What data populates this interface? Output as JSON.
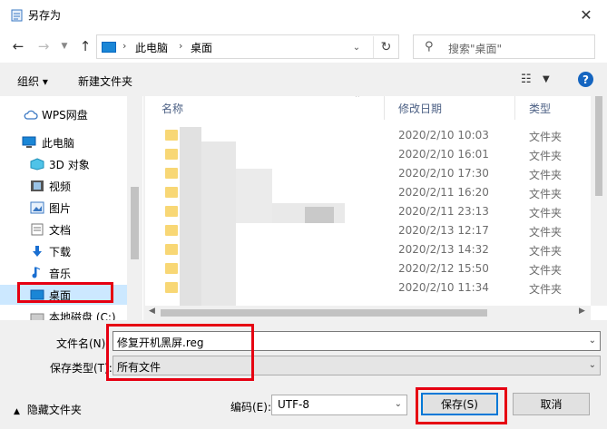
{
  "window": {
    "title": "另存为",
    "close_glyph": "✕"
  },
  "address": {
    "crumbs": [
      "此电脑",
      "桌面"
    ]
  },
  "search": {
    "placeholder": "搜索\"桌面\""
  },
  "toolbar": {
    "organize": "组织 ▾",
    "new_folder": "新建文件夹",
    "help": "?"
  },
  "nav": {
    "items": [
      {
        "label": "WPS网盘",
        "icon": "cloud-icon"
      },
      {
        "label": "此电脑",
        "icon": "computer-icon"
      },
      {
        "label": "3D 对象",
        "icon": "cube-icon"
      },
      {
        "label": "视频",
        "icon": "video-icon"
      },
      {
        "label": "图片",
        "icon": "picture-icon"
      },
      {
        "label": "文档",
        "icon": "document-icon"
      },
      {
        "label": "下载",
        "icon": "download-icon"
      },
      {
        "label": "音乐",
        "icon": "music-icon"
      },
      {
        "label": "桌面",
        "icon": "desktop-icon",
        "selected": true
      },
      {
        "label": "本地磁盘 (C:)",
        "icon": "drive-icon"
      }
    ]
  },
  "file_list": {
    "columns": {
      "name": "名称",
      "modified": "修改日期",
      "type": "类型"
    },
    "rows": [
      {
        "date": "2020/2/10 10:03",
        "type": "文件夹"
      },
      {
        "date": "2020/2/10 16:01",
        "type": "文件夹"
      },
      {
        "date": "2020/2/10 17:30",
        "type": "文件夹"
      },
      {
        "date": "2020/2/11 16:20",
        "type": "文件夹"
      },
      {
        "date": "2020/2/11 23:13",
        "type": "文件夹"
      },
      {
        "date": "2020/2/13 12:17",
        "type": "文件夹"
      },
      {
        "date": "2020/2/13 14:32",
        "type": "文件夹"
      },
      {
        "date": "2020/2/12 15:50",
        "type": "文件夹"
      },
      {
        "date": "2020/2/10 11:34",
        "type": "文件夹"
      }
    ]
  },
  "form": {
    "filename_label": "文件名(N):",
    "filename_value": "修复开机黑屏.reg",
    "filetype_label": "保存类型(T):",
    "filetype_value": "所有文件"
  },
  "footer": {
    "hide_folders": "隐藏文件夹",
    "encoding_label": "编码(E):",
    "encoding_value": "UTF-8",
    "save": "保存(S)",
    "cancel": "取消"
  },
  "colors": {
    "highlight": "#e60012",
    "selection": "#cce8ff",
    "folder": "#f8d775"
  }
}
